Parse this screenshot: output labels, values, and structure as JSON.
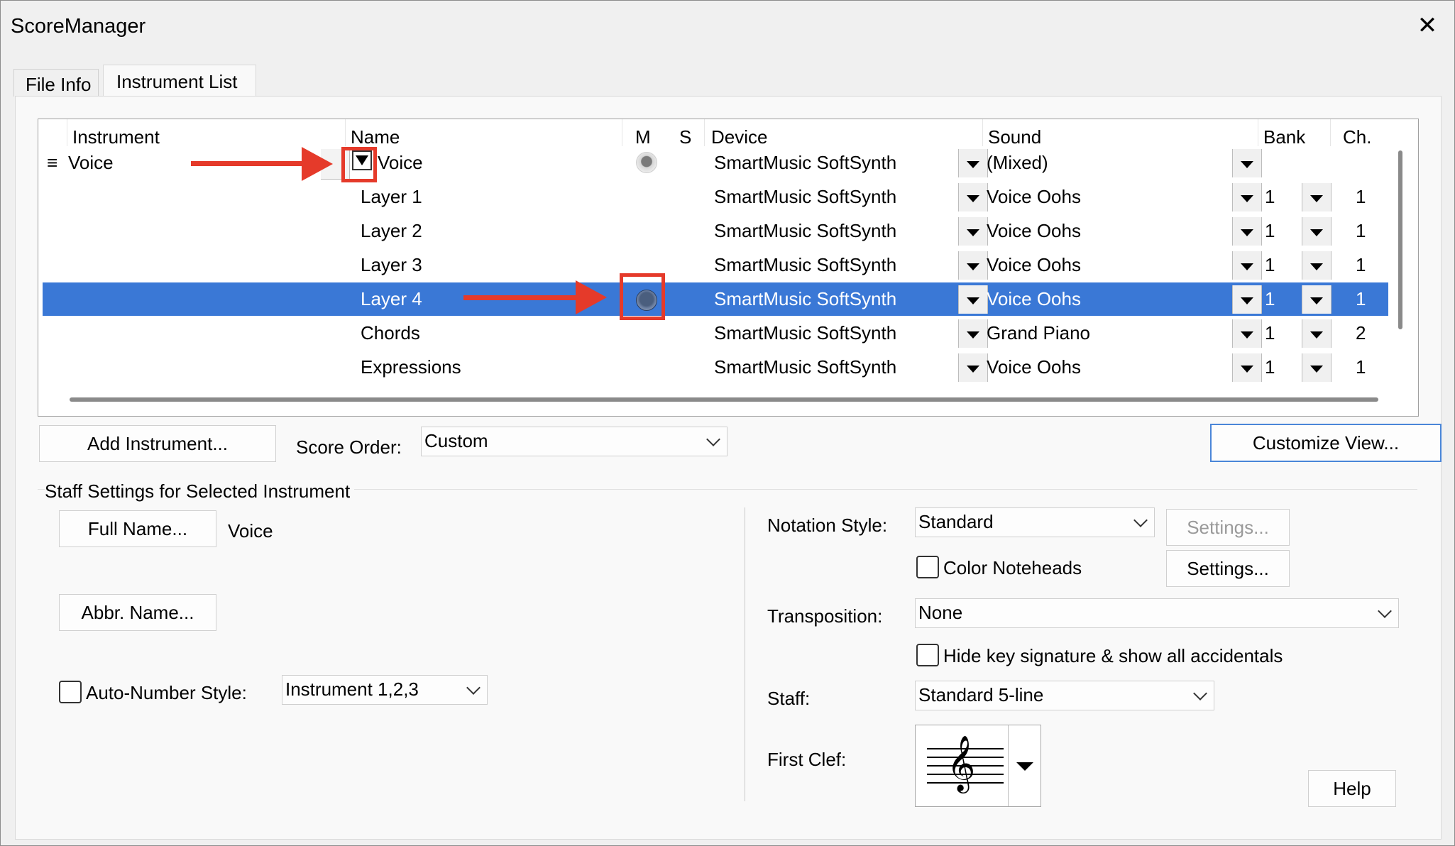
{
  "window": {
    "title": "ScoreManager",
    "close": "✕"
  },
  "tabs": [
    {
      "label": "File Info"
    },
    {
      "label": "Instrument List"
    }
  ],
  "grid": {
    "headers": {
      "instrument": "Instrument",
      "name": "Name",
      "m": "M",
      "s": "S",
      "device": "Device",
      "sound": "Sound",
      "bank": "Bank",
      "ch": "Ch."
    },
    "handle": "≡",
    "instrument": "Voice",
    "rows": [
      {
        "name": "Voice",
        "device": "SmartMusic SoftSynth",
        "sound": "(Mixed)",
        "bank": "",
        "ch": ""
      },
      {
        "name": "Layer 1",
        "device": "SmartMusic SoftSynth",
        "sound": "Voice Oohs",
        "bank": "1",
        "ch": "1"
      },
      {
        "name": "Layer 2",
        "device": "SmartMusic SoftSynth",
        "sound": "Voice Oohs",
        "bank": "1",
        "ch": "1"
      },
      {
        "name": "Layer 3",
        "device": "SmartMusic SoftSynth",
        "sound": "Voice Oohs",
        "bank": "1",
        "ch": "1"
      },
      {
        "name": "Layer 4",
        "device": "SmartMusic SoftSynth",
        "sound": "Voice Oohs",
        "bank": "1",
        "ch": "1"
      },
      {
        "name": "Chords",
        "device": "SmartMusic SoftSynth",
        "sound": "Grand Piano",
        "bank": "1",
        "ch": "2"
      },
      {
        "name": "Expressions",
        "device": "SmartMusic SoftSynth",
        "sound": "Voice Oohs",
        "bank": "1",
        "ch": "1"
      }
    ],
    "selected_row": 4
  },
  "toolbar": {
    "add_instrument": "Add Instrument...",
    "score_order_label": "Score Order:",
    "score_order_value": "Custom",
    "customize_view": "Customize View..."
  },
  "staff_settings": {
    "group_label": "Staff Settings for Selected Instrument",
    "full_name_button": "Full Name...",
    "full_name_value": "Voice",
    "abbr_name_button": "Abbr. Name...",
    "auto_number_label": "Auto-Number Style:",
    "auto_number_value": "Instrument 1,2,3",
    "notation_style_label": "Notation Style:",
    "notation_style_value": "Standard",
    "settings_disabled": "Settings...",
    "color_noteheads": "Color Noteheads",
    "settings": "Settings...",
    "transposition_label": "Transposition:",
    "transposition_value": "None",
    "hide_key_sig": "Hide key signature & show all accidentals",
    "staff_label": "Staff:",
    "staff_value": "Standard 5-line",
    "first_clef_label": "First Clef:",
    "clef_symbol": "𝄞",
    "help": "Help"
  },
  "colors": {
    "selection": "#3a78d6",
    "annotation": "#e53a2a"
  }
}
